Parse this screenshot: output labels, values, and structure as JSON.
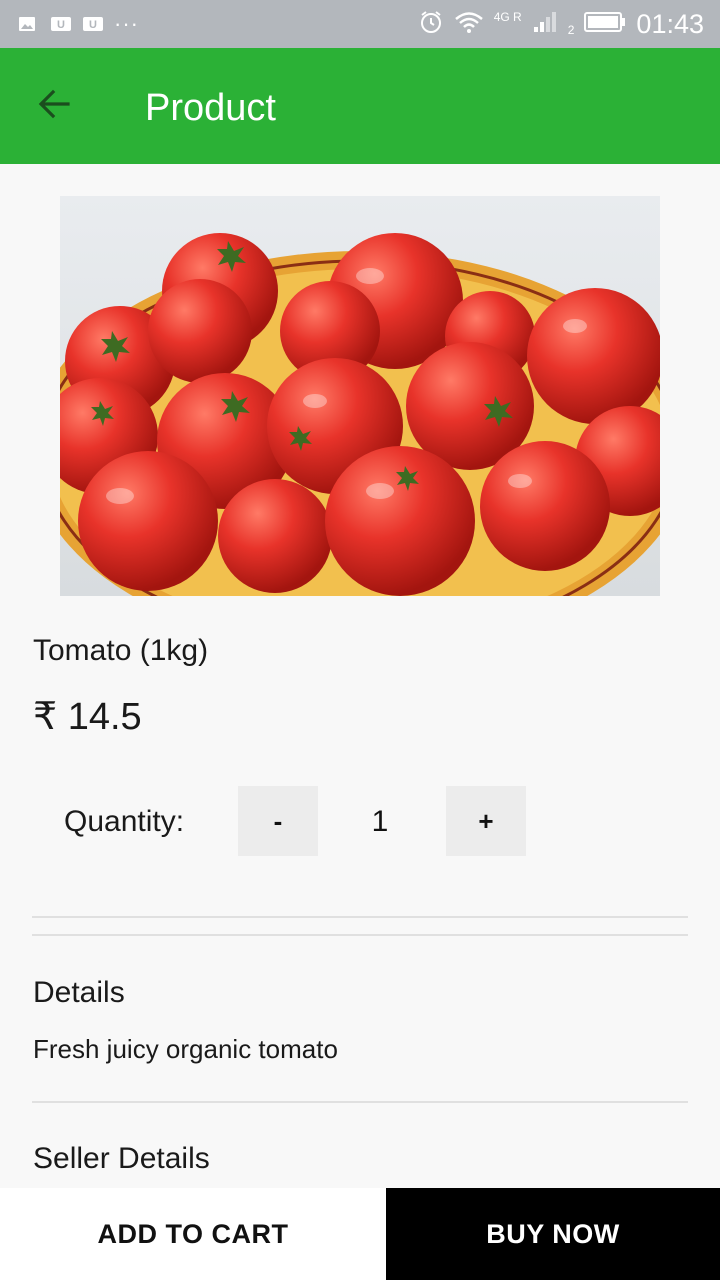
{
  "status_bar": {
    "network": "4G R",
    "sim_slot": "2",
    "time": "01:43",
    "icons": [
      "image-notification-icon",
      "u-app-notification-icon",
      "u-app-notification-icon",
      "more-notifications-icon",
      "alarm-icon",
      "wifi-icon",
      "signal-icon",
      "battery-icon"
    ]
  },
  "app_bar": {
    "title": "Product",
    "back_icon": "arrow-back-icon",
    "color": "#2bb136"
  },
  "product": {
    "name": "Tomato (1kg)",
    "price": "₹ 14.5",
    "image_icon": "tomato-photo"
  },
  "quantity": {
    "label": "Quantity:",
    "decrement_label": "-",
    "value": "1",
    "increment_label": "+"
  },
  "details": {
    "heading": "Details",
    "text": "Fresh juicy organic tomato"
  },
  "seller": {
    "heading": "Seller Details"
  },
  "actions": {
    "add_to_cart": "ADD TO CART",
    "buy_now": "BUY NOW"
  }
}
